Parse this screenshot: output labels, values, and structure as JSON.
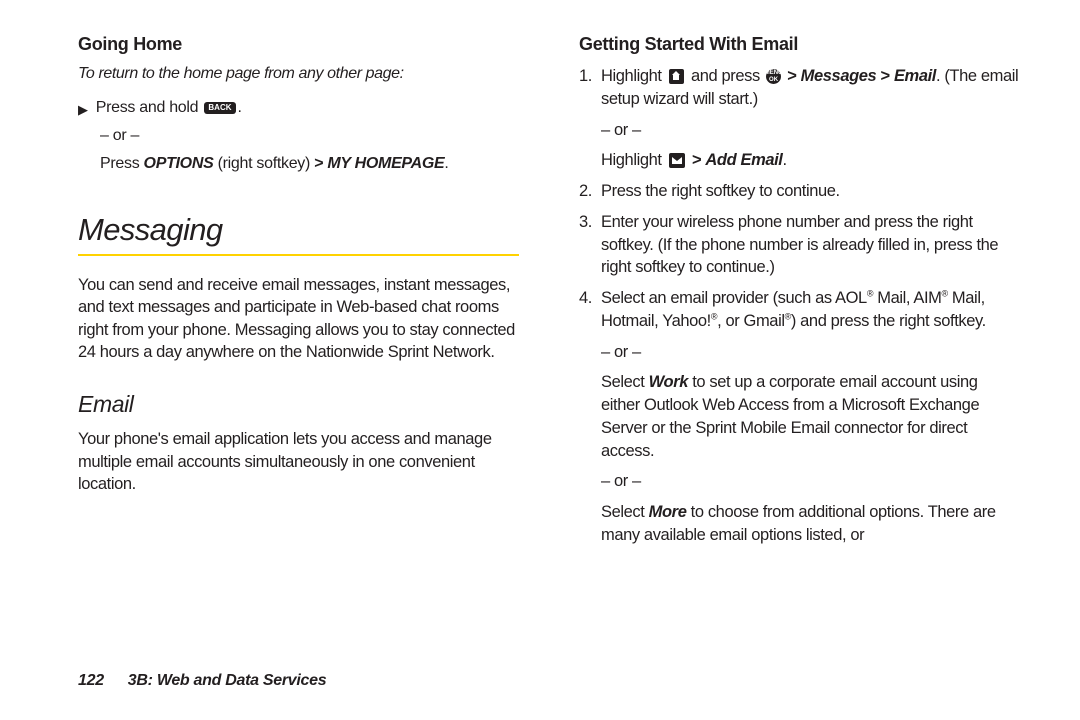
{
  "left": {
    "heading_going_home": "Going Home",
    "intro": "To return to the home page from any other page:",
    "bullet_glyph": "▶",
    "press_hold_pre": "Press and hold ",
    "back_key": "BACK",
    "dot": ".",
    "or": "– or –",
    "press_word": "Press ",
    "options_label": "OPTIONS",
    "right_softkey": " (right softkey) ",
    "gt": ">",
    "my_homepage": " MY HOMEPAGE",
    "section_messaging": "Messaging",
    "messaging_body": "You can send and receive email messages, instant messages, and text messages and participate in Web-based chat rooms right from your phone. Messaging allows you to stay connected 24 hours a day anywhere on the Nationwide Sprint Network.",
    "subsection_email": "Email",
    "email_body": "Your phone's email application lets you access and manage multiple email accounts simultaneously in one convenient location."
  },
  "right": {
    "heading_getting_started": "Getting Started With Email",
    "step1_a": "Highlight ",
    "step1_b": " and press ",
    "menu_ok": "MENU OK",
    "gt": " > ",
    "messages": "Messages",
    "email": "Email",
    "dot": ".",
    "step1_tail": " (The email setup wizard will start.)",
    "or": "– or –",
    "highlight_word": "Highlight ",
    "add_email": "Add Email",
    "step2": "Press the right softkey to continue.",
    "step3": "Enter your wireless phone number and press the right softkey. (If the phone number is already filled in, press the right softkey to continue.)",
    "step4_a": "Select an email provider (such as AOL",
    "reg": "®",
    "step4_b": " Mail, AIM",
    "step4_c": " Mail, Hotmail, Yahoo!",
    "step4_d": ", or Gmail",
    "step4_e": ") and press the right softkey.",
    "work_a": "Select ",
    "work_label": "Work",
    "work_b": " to set up a corporate email account using either Outlook Web Access from a Microsoft Exchange Server or the Sprint Mobile Email connector for direct access.",
    "more_a": "Select ",
    "more_label": "More",
    "more_b": " to choose from additional options. There are many available email options listed, or"
  },
  "footer": {
    "page_no": "122",
    "chapter": "3B: Web and Data Services"
  }
}
